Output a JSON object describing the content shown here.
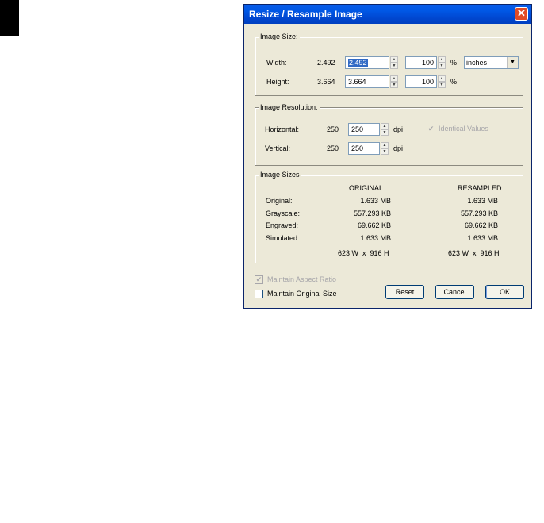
{
  "dialog": {
    "title": "Resize / Resample Image"
  },
  "image_size": {
    "legend": "Image Size:",
    "width_label": "Width:",
    "width_original": "2.492",
    "width_value": "2.492",
    "width_percent": "100",
    "height_label": "Height:",
    "height_original": "3.664",
    "height_value": "3.664",
    "height_percent": "100",
    "percent_symbol": "%",
    "unit_selected": "inches"
  },
  "resolution": {
    "legend": "Image Resolution:",
    "horizontal_label": "Horizontal:",
    "horizontal_original": "250",
    "horizontal_value": "250",
    "vertical_label": "Vertical:",
    "vertical_original": "250",
    "vertical_value": "250",
    "dpi_label": "dpi",
    "identical_values_label": "Identical Values",
    "identical_values_checked": true
  },
  "sizes": {
    "legend": "Image Sizes",
    "col_original": "ORIGINAL",
    "col_resampled": "RESAMPLED",
    "rows": [
      {
        "label": "Original:",
        "original": "1.633 MB",
        "resampled": "1.633 MB"
      },
      {
        "label": "Grayscale:",
        "original": "557.293 KB",
        "resampled": "557.293 KB"
      },
      {
        "label": "Engraved:",
        "original": "69.662 KB",
        "resampled": "69.662 KB"
      },
      {
        "label": "Simulated:",
        "original": "1.633 MB",
        "resampled": "1.633 MB"
      }
    ],
    "dims_original": "623 W  x  916 H",
    "dims_resampled": "623 W  x  916 H"
  },
  "options": {
    "maintain_aspect_label": "Maintain Aspect Ratio",
    "maintain_aspect_checked": true,
    "maintain_original_label": "Maintain Original Size",
    "maintain_original_checked": false
  },
  "buttons": {
    "reset": "Reset",
    "cancel": "Cancel",
    "ok": "OK"
  },
  "colors": {
    "titlebar": "#0054e3",
    "close": "#e14b25",
    "face": "#ece9d8",
    "selection": "#316ac5"
  }
}
